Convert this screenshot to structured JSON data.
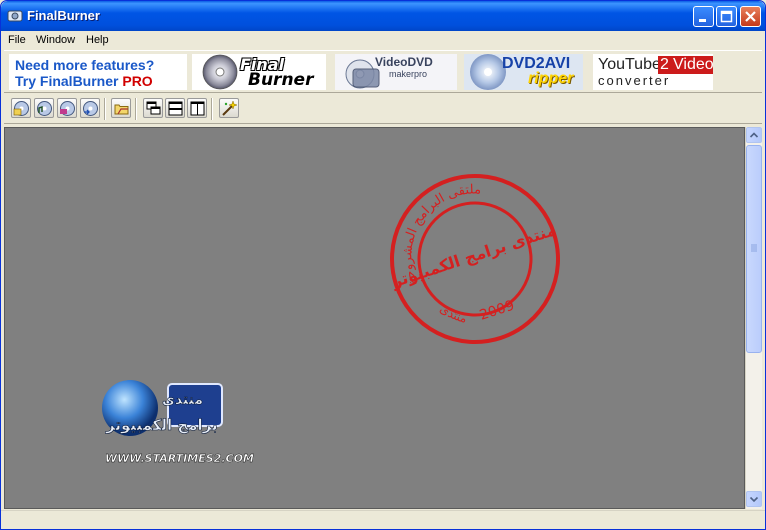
{
  "window": {
    "title": "FinalBurner"
  },
  "menu": [
    {
      "label": "File"
    },
    {
      "label": "Window"
    },
    {
      "label": "Help"
    }
  ],
  "ads": {
    "promo_line1": "Need more features?",
    "promo_line2_a": "Try FinalBurner ",
    "promo_line2_b": "PRO",
    "final_burner_1": "Final",
    "final_burner_2": "Burner",
    "video_dvd_1": "VideoDVD",
    "video_dvd_2": "makerpro",
    "dvd2avi_1": "DVD2AVI",
    "dvd2avi_2": "ripper",
    "youtube_a": "YouTube",
    "youtube_b": "2",
    "youtube_c": "Video",
    "youtube_d": "converter"
  },
  "watermark": {
    "stamp_top": "ملتقى البرامج المشروحة",
    "stamp_mid": "منتدى برامج الكمبيوتر",
    "stamp_bottom": "منتدى",
    "stamp_year": "2009",
    "logo_line1": "منتدى",
    "logo_line2": "برامج الكمبيوتر",
    "logo_url": "WWW.STARTIMES2.COM"
  },
  "colors": {
    "titlebar": "#0055e5",
    "workspace": "#808080",
    "stamp_red": "#d42020",
    "promo_blue": "#1a58c8"
  }
}
